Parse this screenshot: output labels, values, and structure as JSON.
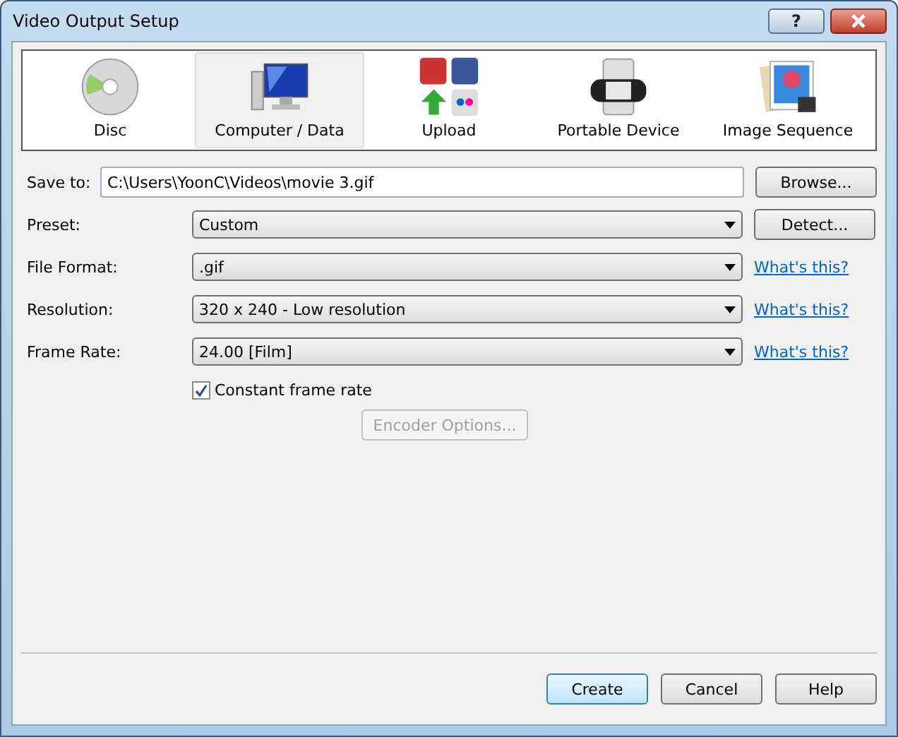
{
  "window": {
    "title": "Video Output Setup",
    "help_label": "?"
  },
  "categories": [
    {
      "label": "Disc",
      "kind": "disc",
      "selected": false
    },
    {
      "label": "Computer / Data",
      "kind": "computer",
      "selected": true
    },
    {
      "label": "Upload",
      "kind": "upload",
      "selected": false
    },
    {
      "label": "Portable Device",
      "kind": "device",
      "selected": false
    },
    {
      "label": "Image Sequence",
      "kind": "sequence",
      "selected": false
    }
  ],
  "save_to": {
    "label": "Save to:",
    "value": "C:\\Users\\YoonC\\Videos\\movie 3.gif",
    "button": "Browse..."
  },
  "fields": [
    {
      "label": "Preset:",
      "value": "Custom",
      "action": {
        "kind": "button",
        "label": "Detect..."
      }
    },
    {
      "label": "File Format:",
      "value": ".gif",
      "action": {
        "kind": "link",
        "label": "What's this?"
      }
    },
    {
      "label": "Resolution:",
      "value": "320 x 240 - Low resolution",
      "action": {
        "kind": "link",
        "label": "What's this?"
      }
    },
    {
      "label": "Frame Rate:",
      "value": "24.00 [Film]",
      "action": {
        "kind": "link",
        "label": "What's this?"
      }
    }
  ],
  "checkbox": {
    "label": "Constant frame rate",
    "checked": true
  },
  "encoder_button": {
    "label": "Encoder Options...",
    "disabled": true
  },
  "buttons": [
    {
      "label": "Create",
      "default": true
    },
    {
      "label": "Cancel",
      "default": false
    },
    {
      "label": "Help",
      "default": false
    }
  ]
}
